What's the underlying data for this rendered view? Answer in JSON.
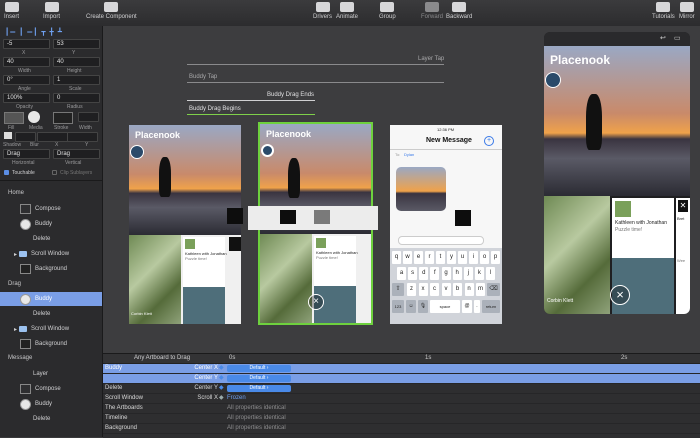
{
  "toolbar": {
    "items": [
      {
        "label": "Insert"
      },
      {
        "label": "Import"
      },
      {
        "label": "Create Component"
      },
      {
        "label": "Drivers"
      },
      {
        "label": "Animate"
      },
      {
        "label": "Group"
      },
      {
        "label": "Forward"
      },
      {
        "label": "Backward"
      },
      {
        "label": "Tutorials"
      },
      {
        "label": "Mirror"
      }
    ]
  },
  "inspector": {
    "x": "-5",
    "y": "53",
    "x_label": "X",
    "y_label": "Y",
    "width": "40",
    "height": "40",
    "width_label": "Width",
    "height_label": "Height",
    "angle": "0°",
    "scale": "1",
    "angle_label": "Angle",
    "scale_label": "Scale",
    "opacity": "100%",
    "radius": "0",
    "opacity_label": "Opacity",
    "radius_label": "Radius",
    "fill_label": "Fill",
    "media_label": "Media",
    "stroke_label": "Stroke",
    "width2_label": "Width",
    "shadow_label": "Shadow",
    "blur_label": "Blur",
    "shadow_x_label": "X",
    "shadow_y_label": "Y",
    "horizontal": "Drag",
    "vertical": "Drag",
    "horizontal_label": "Horizontal",
    "vertical_label": "Vertical",
    "touchable_label": "Touchable",
    "clip_label": "Clip Sublayers"
  },
  "layers": {
    "home": "Home",
    "home_items": [
      "Compose",
      "Buddy",
      "Delete",
      "Scroll Window",
      "Background"
    ],
    "drag": "Drag",
    "drag_items": [
      "Buddy",
      "Delete",
      "Scroll Window",
      "Background"
    ],
    "message": "Message",
    "message_items": [
      "Layer",
      "Compose",
      "Buddy",
      "Delete"
    ]
  },
  "canvas": {
    "gestures": [
      "Layer Tap",
      "Buddy Tap",
      "Buddy Drag Ends",
      "Buddy Drag Begins"
    ],
    "app_title": "Placenook",
    "card_name": "Kathleen with Jonathan",
    "card_sub": "Puzzle time!",
    "card_author": "Corbin Klett",
    "message": {
      "time": "12:36 PM",
      "title": "New Message",
      "to_label": "To:",
      "to_value": "Dylan"
    },
    "keyboard": {
      "row1": [
        "q",
        "w",
        "e",
        "r",
        "t",
        "y",
        "u",
        "i",
        "o",
        "p"
      ],
      "row2": [
        "a",
        "s",
        "d",
        "f",
        "g",
        "h",
        "j",
        "k",
        "l"
      ],
      "row3": [
        "z",
        "x",
        "c",
        "v",
        "b",
        "n",
        "m"
      ],
      "num": "123",
      "space": "space",
      "at": "@",
      "dot": ".",
      "ret": "return"
    },
    "device": {
      "title": "Placenook",
      "card_name": "Kathleen with Jonathan",
      "card_sub": "Puzzle time!",
      "author": "Corbin Klett",
      "side1": "Bret",
      "side2": "Wee"
    }
  },
  "timeline": {
    "transition": "Any Artboard to Drag",
    "ticks": [
      "0s",
      "1s",
      "2s"
    ],
    "rows": [
      {
        "name": "Buddy",
        "prop": "Center X",
        "value": "Default ›",
        "bar": true,
        "selected": true
      },
      {
        "name": "",
        "prop": "Center Y",
        "value": "Default ›",
        "bar": true,
        "selected": true
      },
      {
        "name": "Delete",
        "prop": "Center Y",
        "value": "Default ›",
        "bar": true,
        "selected": false
      },
      {
        "name": "Scroll Window",
        "prop": "Scroll X",
        "value": "Frozen",
        "bar": false,
        "selected": false
      },
      {
        "name": "The Artboards",
        "prop": "",
        "value": "All properties identical",
        "bar": false,
        "selected": false
      },
      {
        "name": "Timeline",
        "prop": "",
        "value": "All properties identical",
        "bar": false,
        "selected": false
      },
      {
        "name": "Background",
        "prop": "",
        "value": "All properties identical",
        "bar": false,
        "selected": false
      }
    ]
  }
}
